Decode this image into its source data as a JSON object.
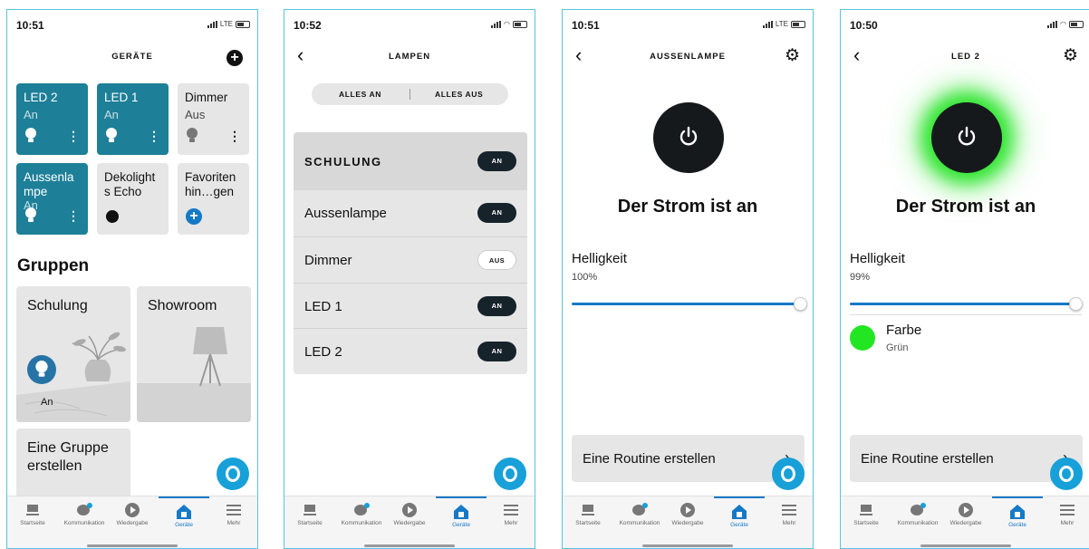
{
  "colors": {
    "tile_on": "#1e7f98",
    "accent": "#1679c6",
    "alexa": "#18a0d8",
    "green_light": "#2ee52e"
  },
  "tabbar": {
    "items": [
      {
        "label": "Startseite",
        "icon": "home-icon"
      },
      {
        "label": "Kommunikation",
        "icon": "chat-icon"
      },
      {
        "label": "Wiedergabe",
        "icon": "play-icon"
      },
      {
        "label": "Geräte",
        "icon": "devices-icon"
      },
      {
        "label": "Mehr",
        "icon": "menu-icon"
      }
    ],
    "active": "Geräte"
  },
  "screen1": {
    "time": "10:51",
    "network": "LTE",
    "title": "GERÄTE",
    "add_label": "+",
    "tiles": [
      {
        "name": "LED 2",
        "state": "An",
        "dots": "⋮"
      },
      {
        "name": "LED 1",
        "state": "An",
        "dots": "⋮"
      },
      {
        "name": "Dimmer",
        "state": "Aus",
        "dots": "⋮"
      },
      {
        "name": "Aussenla mpe",
        "state": "An",
        "dots": "⋮"
      },
      {
        "name": "Dekolight s Echo"
      },
      {
        "name": "Favoriten hin…gen",
        "plus": "+"
      }
    ],
    "groups_title": "Gruppen",
    "groups": [
      {
        "name": "Schulung",
        "state": "An"
      },
      {
        "name": "Showroom"
      }
    ],
    "create_group": "Eine Gruppe erstellen"
  },
  "screen2": {
    "time": "10:52",
    "back": "‹",
    "title": "LAMPEN",
    "all_on": "ALLES AN",
    "all_off": "ALLES AUS",
    "group": {
      "name": "SCHULUNG",
      "state": "AN"
    },
    "rows": [
      {
        "name": "Aussenlampe",
        "state": "AN",
        "on": true
      },
      {
        "name": "Dimmer",
        "state": "AUS",
        "on": false
      },
      {
        "name": "LED 1",
        "state": "AN",
        "on": true
      },
      {
        "name": "LED 2",
        "state": "AN",
        "on": true
      }
    ]
  },
  "screen3": {
    "time": "10:51",
    "network": "LTE",
    "back": "‹",
    "title": "AUSSENLAMPE",
    "settings_glyph": "⚙",
    "status": "Der Strom ist an",
    "brightness_label": "Helligkeit",
    "brightness_value": "100%",
    "brightness_level": 1.0,
    "routine": "Eine Routine erstellen",
    "chevron": "›"
  },
  "screen4": {
    "time": "10:50",
    "back": "‹",
    "title": "LED 2",
    "settings_glyph": "⚙",
    "status": "Der Strom ist an",
    "brightness_label": "Helligkeit",
    "brightness_value": "99%",
    "brightness_level": 0.99,
    "color_label": "Farbe",
    "color_value": "Grün",
    "routine": "Eine Routine erstellen",
    "chevron": "›"
  }
}
